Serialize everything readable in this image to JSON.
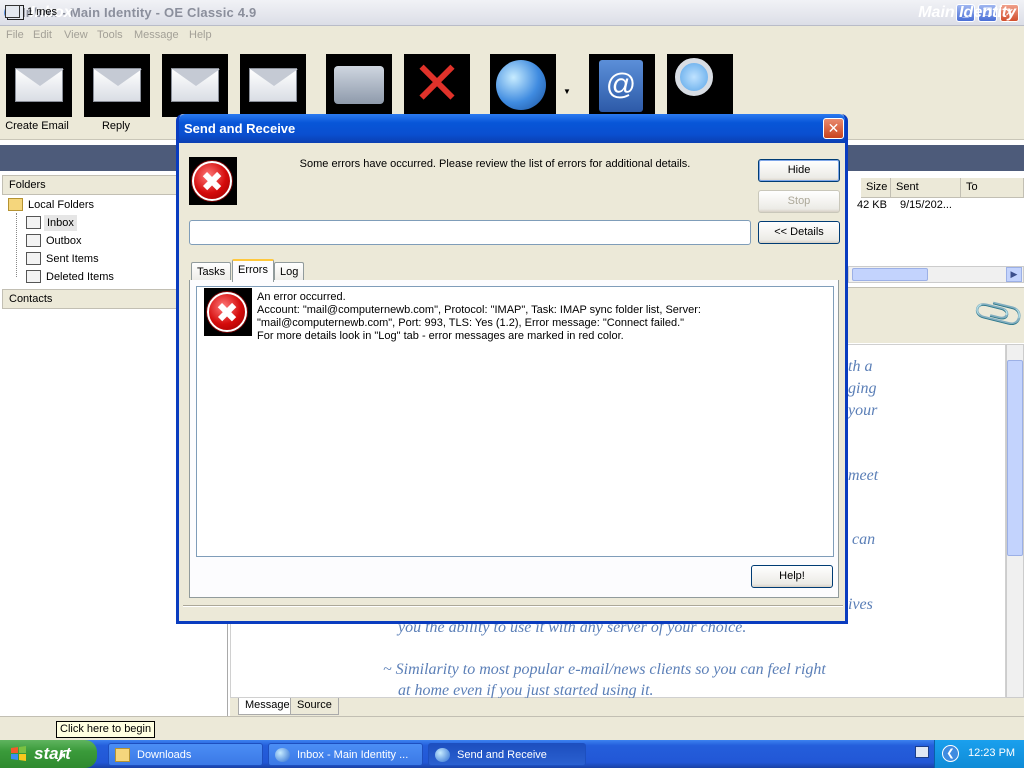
{
  "window": {
    "title": "Inbox - Main Identity - OE Classic 4.9",
    "controls": [
      "minimize",
      "maximize",
      "close"
    ]
  },
  "menu": [
    "File",
    "Edit",
    "View",
    "Tools",
    "Message",
    "Help"
  ],
  "toolbar": {
    "create_email": "Create Email",
    "reply": "Reply"
  },
  "header": {
    "folder_title": "Inbox",
    "identity": "Main Identity"
  },
  "folders": {
    "header": "Folders",
    "root": "Local Folders",
    "items": [
      {
        "label": "Inbox",
        "selected": true
      },
      {
        "label": "Outbox"
      },
      {
        "label": "Sent Items"
      },
      {
        "label": "Deleted Items"
      }
    ]
  },
  "contacts": {
    "header": "Contacts"
  },
  "message_list": {
    "columns": [
      "Size",
      "Sent",
      "To"
    ],
    "rows": [
      {
        "size": "42 KB",
        "sent": "9/15/202..."
      }
    ]
  },
  "preview": {
    "lines": [
      "th a",
      "ging",
      "your",
      "meet",
      "can",
      "ives",
      "you the ability to use it with any server of your choice.",
      "~ Similarity to most popular e-mail/news clients so you can feel right",
      "at home even if you just started using it."
    ],
    "tabs": [
      "Message",
      "Source"
    ]
  },
  "status": {
    "text": "1 mes",
    "tooltip": "Click here to begin"
  },
  "dialog": {
    "title": "Send and Receive",
    "message": "Some errors have occurred. Please review the list of errors for additional details.",
    "buttons": {
      "hide": "Hide",
      "stop": "Stop",
      "details": "<< Details",
      "help": "Help!"
    },
    "tabs": [
      "Tasks",
      "Errors",
      "Log"
    ],
    "active_tab": "Errors",
    "errors": [
      {
        "lines": [
          "An error occurred.",
          "Account: \"mail@computernewb.com\", Protocol: \"IMAP\", Task: IMAP sync folder list, Server:",
          "\"mail@computernewb.com\", Port: 993, TLS: Yes (1.2), Error message: \"Connect failed.\"",
          "For more details look in \"Log\" tab - error messages are marked in red color."
        ]
      }
    ]
  },
  "taskbar": {
    "start": "start",
    "tasks": [
      {
        "label": "Downloads",
        "active": false
      },
      {
        "label": "Inbox - Main Identity ...",
        "active": false
      },
      {
        "label": "Send and Receive",
        "active": true
      }
    ],
    "clock": "12:23 PM"
  },
  "colors": {
    "dialog_title": "#0a4fd0",
    "band": "#4d5b7a",
    "preview_text": "#5b7fb7",
    "error_red": "#d40b0b"
  }
}
